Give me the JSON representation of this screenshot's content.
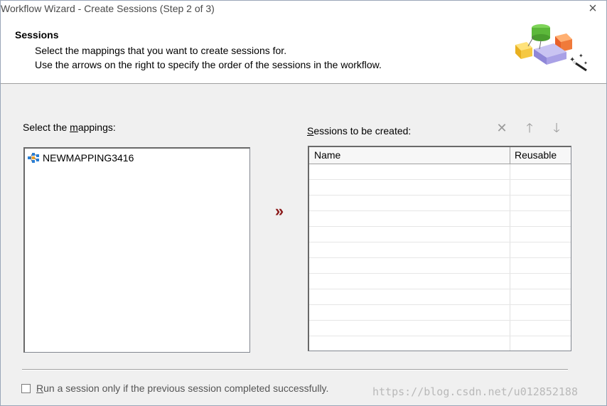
{
  "window": {
    "title": "Workflow Wizard - Create Sessions (Step 2 of 3)",
    "close_glyph": "×"
  },
  "header": {
    "heading": "Sessions",
    "line1": "Select the mappings that you want to create sessions for.",
    "line2": "Use the arrows on the right to specify the order of the sessions in the workflow.",
    "graphic_icon": "wizard-magic-wand-icon"
  },
  "left_panel": {
    "label_prefix": "Select the ",
    "label_mnemonic": "m",
    "label_suffix": "appings:",
    "mappings": [
      {
        "name": "NEWMAPPING3416",
        "icon": "mapping-icon"
      }
    ]
  },
  "add_button": {
    "glyph": "»",
    "icon": "double-chevron-right-icon"
  },
  "right_panel": {
    "label_mnemonic": "S",
    "label_suffix": "essions to be created:",
    "toolbar": {
      "delete_glyph": "✕",
      "up_glyph": "🡑",
      "down_glyph": "🡓"
    },
    "columns": [
      "Name",
      "Reusable"
    ],
    "rows": []
  },
  "footer": {
    "checkbox_mnemonic": "R",
    "checkbox_label": "un a session only if the previous session completed successfully.",
    "checked": false
  },
  "watermark": "https://blog.csdn.net/u012852188",
  "colors": {
    "add_arrow": "#8b1a1a",
    "toolbar_disabled": "#9a9a9a"
  }
}
